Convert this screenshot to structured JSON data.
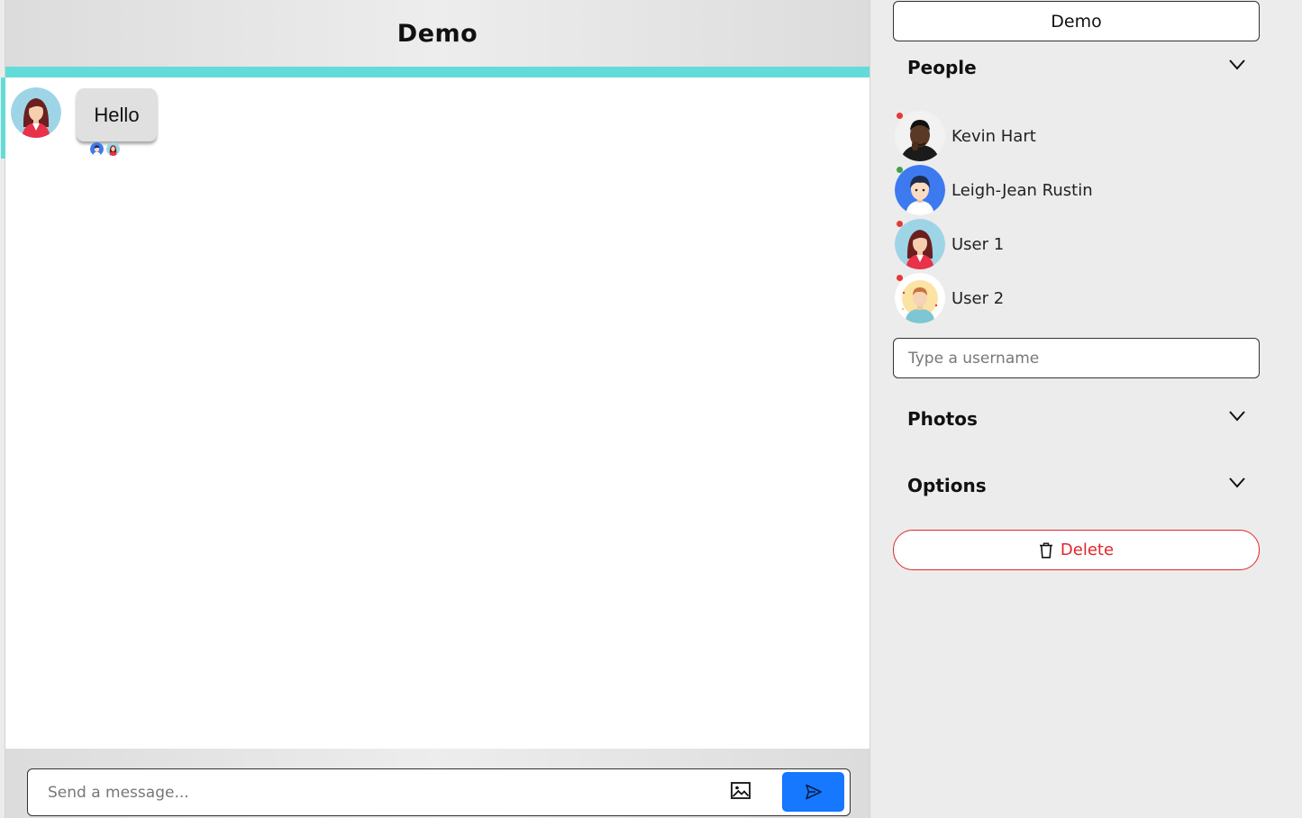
{
  "chat": {
    "title": "Demo",
    "messages": [
      {
        "text": "Hello",
        "sender": "User 1",
        "read_by": [
          "Leigh-Jean Rustin",
          "User 1"
        ]
      }
    ],
    "composer": {
      "placeholder": "Send a message..."
    }
  },
  "sidebar": {
    "title_button": "Demo",
    "people_section": "People",
    "people": [
      {
        "name": "Kevin Hart",
        "status": "offline",
        "status_color": "#e53935"
      },
      {
        "name": "Leigh-Jean Rustin",
        "status": "online",
        "status_color": "#43a047"
      },
      {
        "name": "User 1",
        "status": "offline",
        "status_color": "#e53935"
      },
      {
        "name": "User 2",
        "status": "offline",
        "status_color": "#e53935"
      }
    ],
    "username_placeholder": "Type a username",
    "photos_section": "Photos",
    "options_section": "Options",
    "delete_label": "Delete"
  },
  "colors": {
    "accent": "#63dcd9",
    "send_button": "#1677ff",
    "danger": "#e0262b"
  },
  "icons": [
    "image-icon",
    "send-icon",
    "chevron-down-icon",
    "trash-icon"
  ]
}
